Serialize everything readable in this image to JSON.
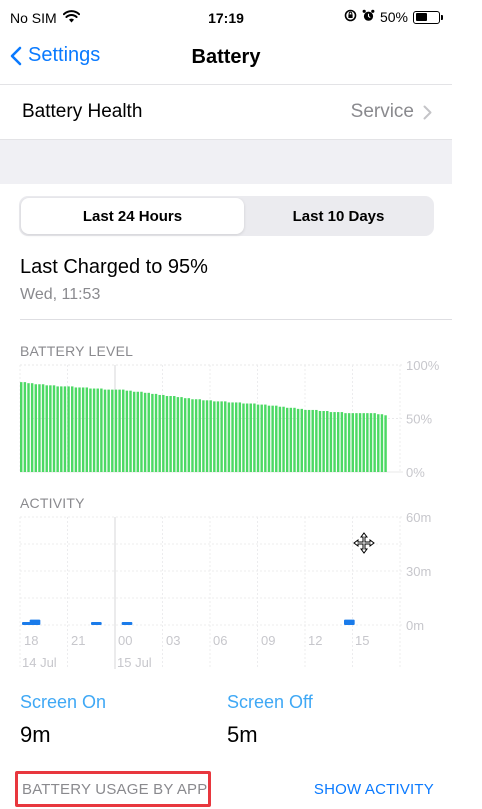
{
  "status_bar": {
    "carrier": "No SIM",
    "time": "17:19",
    "battery_percent": "50%",
    "battery_level": 0.5,
    "icons": [
      "wifi-icon",
      "orientation-lock-icon",
      "alarm-icon",
      "battery-icon"
    ]
  },
  "nav": {
    "back_label": "Settings",
    "title": "Battery"
  },
  "battery_health": {
    "label": "Battery Health",
    "value": "Service"
  },
  "segmented": {
    "options": [
      "Last 24 Hours",
      "Last 10 Days"
    ],
    "selected": "Last 24 Hours"
  },
  "last_charged": {
    "title": "Last Charged to 95%",
    "time": "Wed, 11:53"
  },
  "colors": {
    "battery_bar": "#4cd964",
    "activity_bar": "#1a7bea",
    "accent": "#0a7aff",
    "highlight_box": "#e8373e"
  },
  "chart_data": [
    {
      "type": "bar",
      "title": "BATTERY LEVEL",
      "y_ticks": [
        "100%",
        "50%",
        "0%"
      ],
      "ylim": [
        0,
        100
      ],
      "values": [
        84,
        84,
        83,
        83,
        82,
        82,
        82,
        81,
        81,
        81,
        80,
        80,
        80,
        80,
        80,
        79,
        79,
        79,
        79,
        78,
        78,
        78,
        78,
        77,
        77,
        77,
        77,
        77,
        77,
        76,
        76,
        75,
        75,
        75,
        74,
        74,
        73,
        73,
        72,
        72,
        71,
        71,
        71,
        70,
        70,
        69,
        69,
        68,
        68,
        68,
        67,
        67,
        67,
        66,
        66,
        66,
        66,
        65,
        65,
        65,
        65,
        64,
        64,
        64,
        64,
        63,
        63,
        63,
        62,
        62,
        62,
        61,
        61,
        60,
        60,
        60,
        59,
        59,
        58,
        58,
        58,
        58,
        57,
        57,
        57,
        56,
        56,
        56,
        56,
        55,
        55,
        55,
        55,
        55,
        55,
        55,
        55,
        55,
        54,
        54,
        53
      ]
    },
    {
      "type": "bar",
      "title": "ACTIVITY",
      "y_ticks": [
        "60m",
        "30m",
        "0m"
      ],
      "ylim": [
        0,
        60
      ],
      "x_ticks": [
        "18",
        "21",
        "00",
        "03",
        "06",
        "09",
        "12",
        "15"
      ],
      "date_labels": [
        "14 Jul",
        "15 Jul"
      ],
      "series": [
        {
          "name": "Screen On",
          "values": [
            1.5,
            3,
            0,
            0,
            0,
            0,
            0,
            0,
            0,
            0,
            0,
            0,
            0,
            0,
            0,
            0,
            0,
            0,
            0,
            0,
            0,
            0,
            0,
            0,
            0,
            0,
            0,
            0,
            0,
            0,
            0,
            0,
            0,
            0,
            0,
            0,
            0,
            0,
            0,
            0,
            0,
            0,
            0,
            0,
            0,
            0,
            0,
            3
          ]
        },
        {
          "name": "Screen Off",
          "values": [
            0,
            0,
            0,
            0,
            0,
            0,
            0,
            0,
            0,
            0,
            0,
            0,
            0,
            0,
            0,
            0,
            0,
            0,
            0,
            0,
            0,
            0,
            0,
            0,
            0,
            0,
            0,
            0,
            0,
            0,
            0,
            0,
            0,
            0,
            0,
            0,
            0,
            0,
            0,
            0,
            0,
            0,
            0,
            0,
            0,
            0,
            0,
            0
          ]
        }
      ],
      "markers": [
        {
          "slot": 0,
          "value": 1.5
        },
        {
          "slot": 1,
          "value": 3
        },
        {
          "slot": 9,
          "value": 1.5
        },
        {
          "slot": 13,
          "value": 1.5
        },
        {
          "slot": 42,
          "value": 3
        }
      ]
    }
  ],
  "stats": {
    "screen_on_label": "Screen On",
    "screen_on_value": "9m",
    "screen_off_label": "Screen Off",
    "screen_off_value": "5m"
  },
  "usage": {
    "label": "BATTERY USAGE BY APP",
    "action": "SHOW ACTIVITY"
  }
}
